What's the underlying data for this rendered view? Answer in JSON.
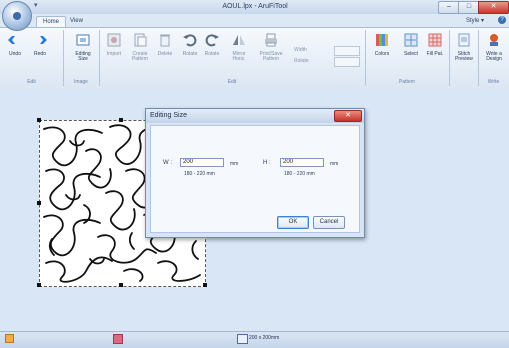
{
  "window": {
    "title": "AOUL.lpx - AruFiTool"
  },
  "tabs": [
    {
      "label": "Home"
    },
    {
      "label": "View"
    }
  ],
  "style_menu": "Style ▾",
  "ribbon": {
    "buttons": [
      {
        "label": "Undo",
        "icon": "undo-arrow-icon",
        "color": "#2f7ad6"
      },
      {
        "label": "Redo",
        "icon": "redo-arrow-icon",
        "color": "#2f7ad6"
      },
      {
        "label": "Editing\nSize",
        "icon": "editing-size-icon",
        "color": "#4a78b6"
      },
      {
        "label": "Import",
        "icon": "import-icon",
        "color": "#9aa8b8"
      },
      {
        "label": "Create\nPattern",
        "icon": "create-pattern-icon",
        "color": "#9aa8b8"
      },
      {
        "label": "Delete",
        "icon": "delete-icon",
        "color": "#9aa8b8"
      },
      {
        "label": "Rotate",
        "icon": "rotate-left-icon",
        "color": "#8f9cab"
      },
      {
        "label": "Rotate",
        "icon": "rotate-right-icon",
        "color": "#8f9cab"
      },
      {
        "label": "Mirror\nHoriz.",
        "icon": "mirror-icon",
        "color": "#8f9cab"
      },
      {
        "label": "Print/Save\nPattern",
        "icon": "print-icon",
        "color": "#8f9cab"
      },
      {
        "label": "Colors",
        "icon": "colors-icon",
        "color": "#6a9fe0"
      },
      {
        "label": "Select",
        "icon": "select-icon",
        "color": "#5b8fd0"
      },
      {
        "label": "Fill Pat.",
        "icon": "fill-pattern-icon",
        "color": "#d36a6a"
      },
      {
        "label": "Stitch\nPreview",
        "icon": "stitch-preview-icon",
        "color": "#7aa0c8"
      },
      {
        "label": "Write a\nDesign",
        "icon": "write-design-icon",
        "color": "#d65b2a"
      }
    ],
    "small_controls": [
      {
        "label": "Width"
      },
      {
        "label": "Rotate"
      }
    ],
    "groups": [
      {
        "label": "Edit"
      },
      {
        "label": "Image"
      },
      {
        "label": "Edit"
      },
      {
        "label": "Pattern"
      },
      {
        "label": "Write"
      }
    ]
  },
  "dialog": {
    "title": "Editing Size",
    "width": {
      "label": "W :",
      "value": "200",
      "unit": "mm",
      "range": "180 - 220 mm"
    },
    "height": {
      "label": "H :",
      "value": "200",
      "unit": "mm",
      "range": "180 - 220 mm"
    },
    "ok_label": "OK",
    "cancel_label": "Cancel"
  },
  "status": {
    "size": "200 x 200mm"
  },
  "colors": {
    "accent": "#3d7fd1",
    "close": "#c8372a",
    "workspace": "#d9e6f5"
  }
}
